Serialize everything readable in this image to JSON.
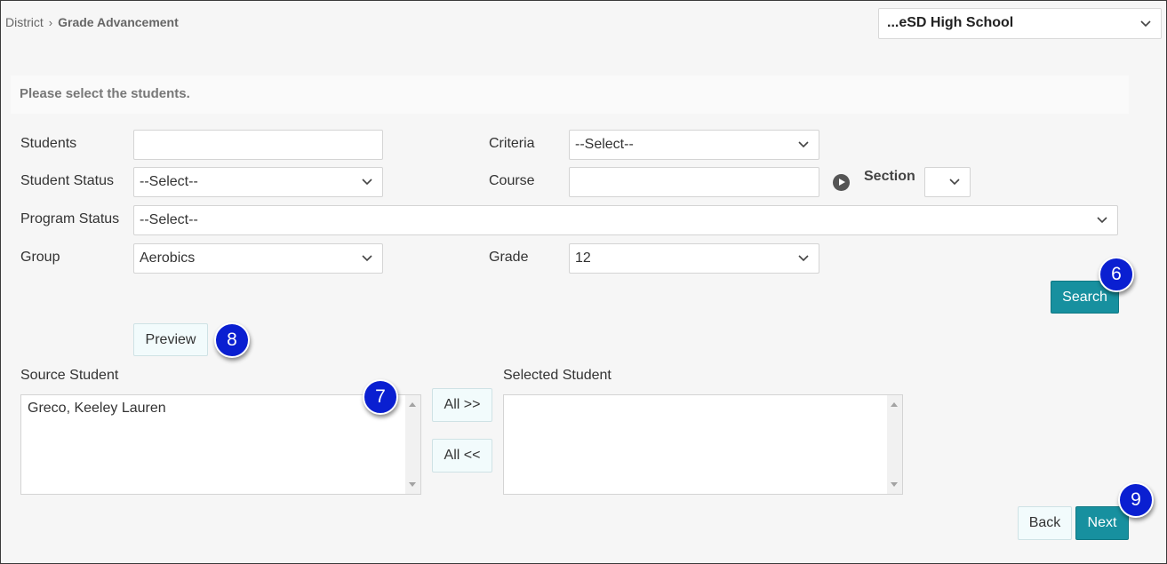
{
  "breadcrumb": {
    "root": "District",
    "current": "Grade Advancement"
  },
  "school_select": {
    "value": "...eSD High School"
  },
  "banner": "Please select the students.",
  "form": {
    "students": {
      "label": "Students",
      "value": ""
    },
    "criteria": {
      "label": "Criteria",
      "value": "--Select--"
    },
    "student_status": {
      "label": "Student Status",
      "value": "--Select--"
    },
    "course": {
      "label": "Course",
      "value": ""
    },
    "section": {
      "label": "Section",
      "value": ""
    },
    "program_status": {
      "label": "Program Status",
      "value": "--Select--"
    },
    "group": {
      "label": "Group",
      "value": "Aerobics"
    },
    "grade": {
      "label": "Grade",
      "value": "12"
    }
  },
  "buttons": {
    "search": "Search",
    "preview": "Preview",
    "all_right": "All >>",
    "all_left": "All <<",
    "back": "Back",
    "next": "Next"
  },
  "source": {
    "label": "Source Student",
    "items": [
      "Greco, Keeley Lauren"
    ]
  },
  "selected": {
    "label": "Selected Student",
    "items": []
  },
  "badges": {
    "search": "6",
    "source": "7",
    "preview": "8",
    "next": "9"
  },
  "colors": {
    "primary": "#17909f",
    "badge": "#0a1fd1"
  },
  "icons": {
    "dropdown": "chevron-down-icon",
    "play": "play-circle-icon",
    "breadcrumb_sep": "chevron-right-icon"
  }
}
